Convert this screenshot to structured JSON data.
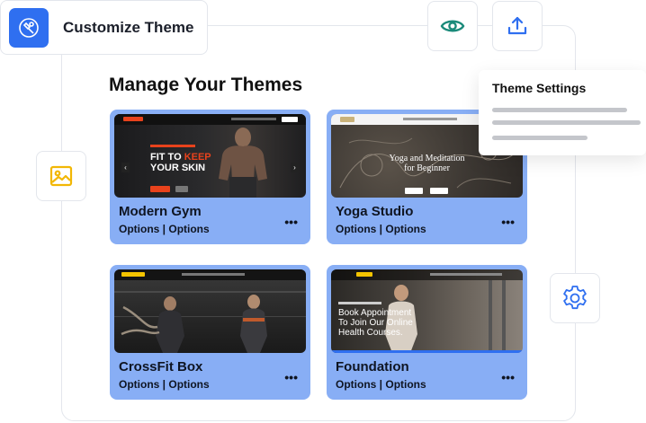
{
  "header": {
    "title": "Customize Theme",
    "logo_icon": "wrench-badge-icon",
    "preview_icon": "eye-icon",
    "export_icon": "upload-icon"
  },
  "main": {
    "title": "Manage Your Themes"
  },
  "settings_popover": {
    "title": "Theme Settings"
  },
  "side_icons": {
    "image_icon": "image-icon",
    "settings_icon": "gear-icon"
  },
  "themes": [
    {
      "name": "Modern Gym",
      "options": "Options | Options",
      "menu": "•••",
      "preview": {
        "headline_1": "FIT TO ",
        "headline_accent": "KEEP",
        "headline_2": "YOUR SKIN"
      }
    },
    {
      "name": "Yoga Studio",
      "options": "Options | Options",
      "menu": "•••",
      "preview": {
        "headline_1": "Yoga and Meditation",
        "headline_2": "for Beginner"
      }
    },
    {
      "name": "CrossFit Box",
      "options": "Options | Options",
      "menu": "•••",
      "preview": {}
    },
    {
      "name": "Foundation",
      "options": "Options | Options",
      "menu": "•••",
      "preview": {
        "headline_1": "Book Appointment",
        "headline_2": "To Join Our Online",
        "headline_3": "Health Courses."
      }
    }
  ],
  "colors": {
    "accent": "#2f6ff0",
    "card_bg": "#88aef5",
    "eye_icon": "#1a8a7a",
    "upload_icon": "#2f6ff0",
    "image_icon": "#f2b705",
    "gear_icon": "#2f6ff0",
    "gym_accent": "#e8421c"
  }
}
